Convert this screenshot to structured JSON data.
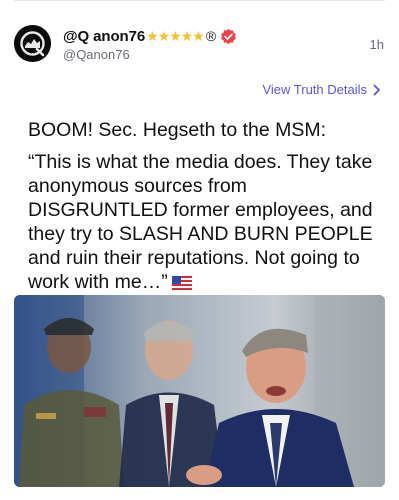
{
  "post": {
    "display_name": "@Q anon76",
    "name_stars": "★★★★★",
    "name_registered": "®",
    "handle": "@Qanon76",
    "timestamp": "1h",
    "details_link": "View Truth Details",
    "text_line_1": "BOOM! Sec. Hegseth to the MSM:",
    "text_line_2": "“This is what the media does. They take anonymous sources from DISGRUNTLED former employees, and they try to SLASH AND BURN PEOPLE and ruin their reputations. Not going to work with me…”",
    "flag_icon": "us-flag-icon",
    "verified_icon": "verified-badge-icon",
    "colors": {
      "link": "#5b57d6",
      "verified": "#f0424c",
      "stars": "#f2c230"
    }
  }
}
